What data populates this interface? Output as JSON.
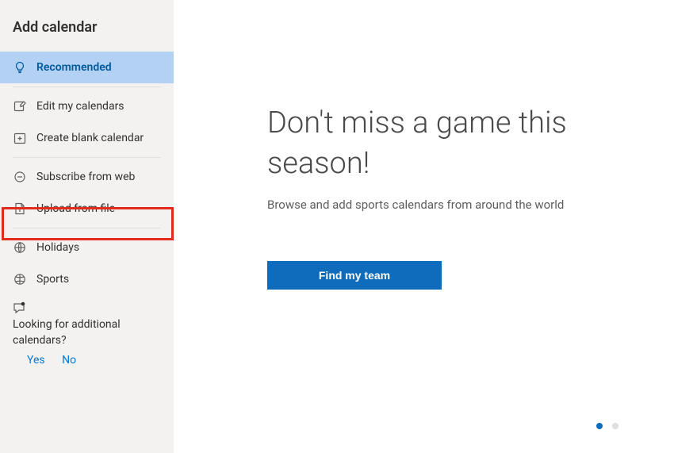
{
  "sidebar": {
    "title": "Add calendar",
    "items": {
      "recommended": "Recommended",
      "edit": "Edit my calendars",
      "create": "Create blank calendar",
      "subscribe": "Subscribe from web",
      "upload": "Upload from file",
      "holidays": "Holidays",
      "sports": "Sports"
    },
    "feedback": {
      "prompt": "Looking for additional calendars?",
      "yes": "Yes",
      "no": "No"
    }
  },
  "main": {
    "title": "Don't miss a game this season!",
    "subtitle": "Browse and add sports calendars from around the world",
    "cta": "Find my team"
  }
}
